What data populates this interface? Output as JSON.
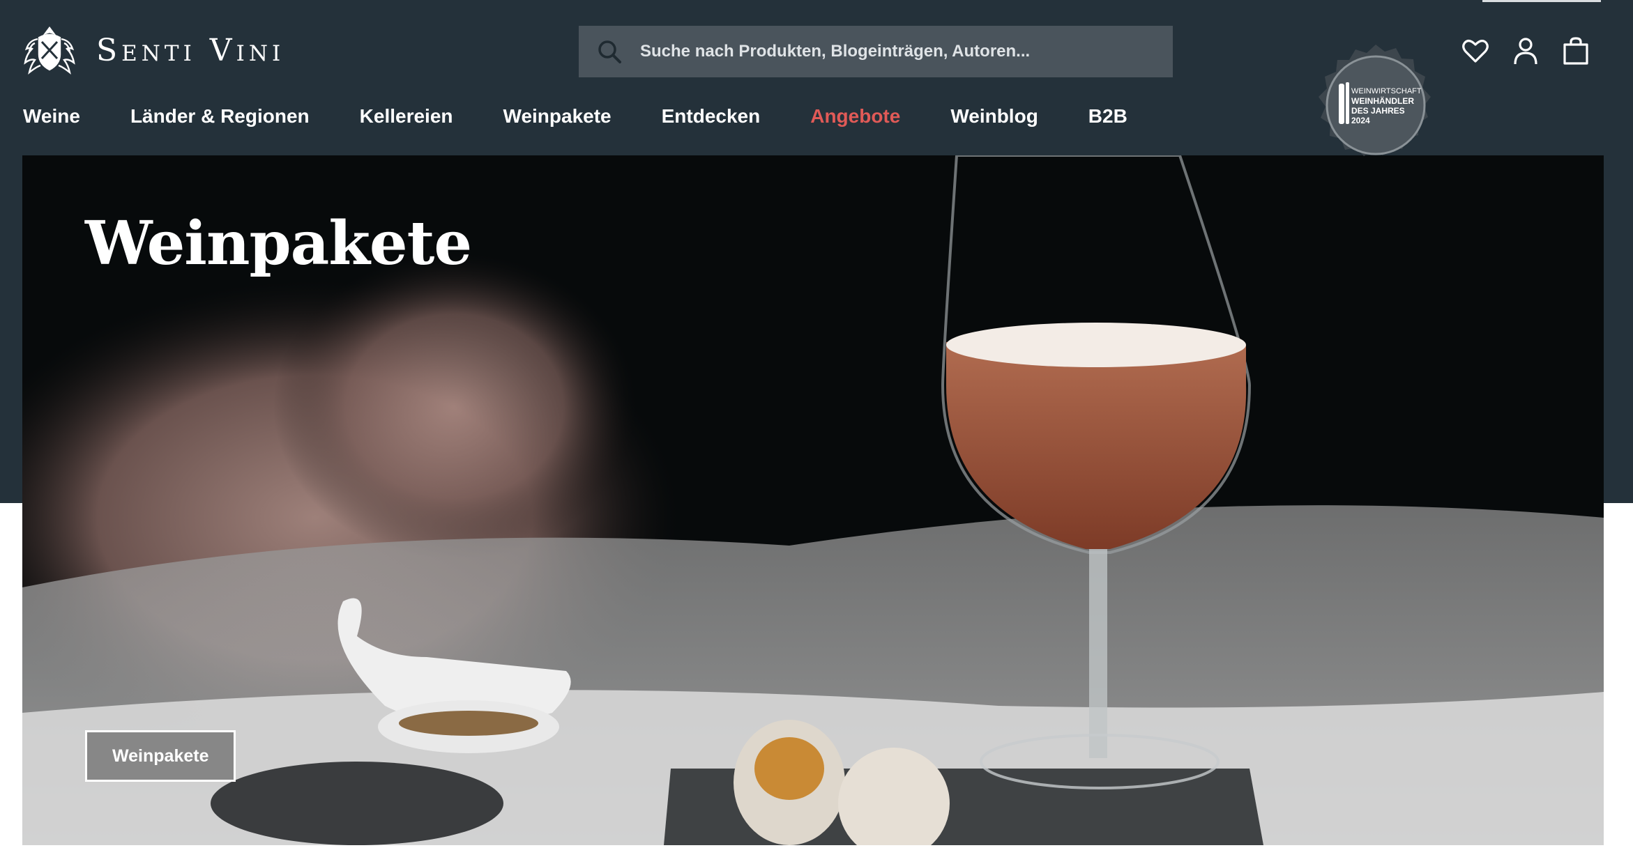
{
  "brand": {
    "name": "Senti Vini",
    "logo_icon": "crest-icon"
  },
  "search": {
    "placeholder": "Suche nach Produkten, Blogeinträgen, Autoren...",
    "icon": "search-icon"
  },
  "header_icons": [
    "heart-icon",
    "user-icon",
    "shopping-bag-icon"
  ],
  "nav": {
    "items": [
      {
        "label": "Weine"
      },
      {
        "label": "Länder & Regionen"
      },
      {
        "label": "Kellereien"
      },
      {
        "label": "Weinpakete"
      },
      {
        "label": "Entdecken"
      },
      {
        "label": "Angebote",
        "accent": true
      },
      {
        "label": "Weinblog"
      },
      {
        "label": "B2B"
      }
    ]
  },
  "badge": {
    "line1": "WEINWIRTSCHAFT",
    "line2": "WEINHÄNDLER",
    "line3": "DES JAHRES",
    "line4": "2024"
  },
  "hero": {
    "title": "Weinpakete",
    "button_label": "Weinpakete"
  },
  "colors": {
    "header_bg": "#24313a",
    "search_bg": "#4a545c",
    "accent": "#e05a57",
    "text": "#ffffff"
  }
}
